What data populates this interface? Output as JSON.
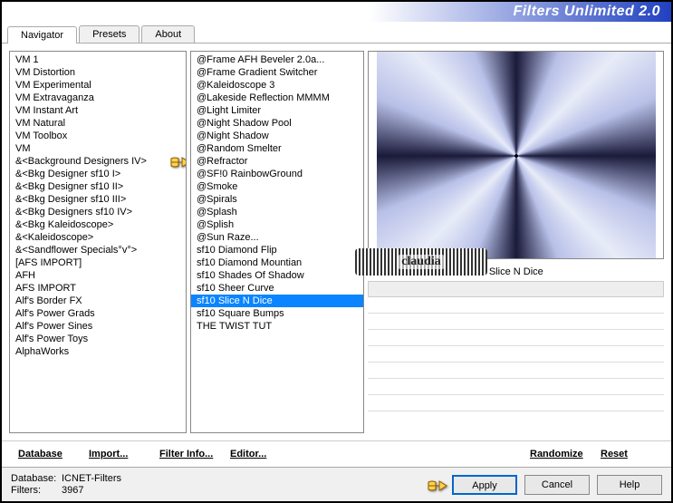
{
  "title": "Filters Unlimited 2.0",
  "tabs": [
    "Navigator",
    "Presets",
    "About"
  ],
  "categories": [
    "VM 1",
    "VM Distortion",
    "VM Experimental",
    "VM Extravaganza",
    "VM Instant Art",
    "VM Natural",
    "VM Toolbox",
    "VM",
    "&<Background Designers IV>",
    "&<Bkg Designer sf10 I>",
    "&<Bkg Designer sf10 II>",
    "&<Bkg Designer sf10 III>",
    "&<Bkg Designers sf10 IV>",
    "&<Bkg Kaleidoscope>",
    "&<Kaleidoscope>",
    "&<Sandflower Specials°v°>",
    "[AFS IMPORT]",
    "AFH",
    "AFS IMPORT",
    "Alf's Border FX",
    "Alf's Power Grads",
    "Alf's Power Sines",
    "Alf's Power Toys",
    "AlphaWorks"
  ],
  "category_pointer_index": 8,
  "filters": [
    "@Frame AFH Beveler 2.0a...",
    "@Frame Gradient Switcher",
    "@Kaleidoscope 3",
    "@Lakeside Reflection MMMM",
    "@Light Limiter",
    "@Night Shadow Pool",
    "@Night Shadow",
    "@Random Smelter",
    "@Refractor",
    "@SF!0 RainbowGround",
    "@Smoke",
    "@Spirals",
    "@Splash",
    "@Splish",
    "@Sun Raze...",
    "sf10 Diamond Flip",
    "sf10 Diamond Mountian",
    "sf10 Shades Of Shadow",
    "sf10 Sheer Curve",
    "sf10 Slice N Dice",
    "sf10 Square Bumps",
    "THE TWIST TUT"
  ],
  "filter_selected_index": 19,
  "preview_label": "sf10 Slice N Dice",
  "toolbar": {
    "database": "Database",
    "import": "Import...",
    "filter_info": "Filter Info...",
    "editor": "Editor...",
    "randomize": "Randomize",
    "reset": "Reset"
  },
  "footer": {
    "db_label": "Database:",
    "db_value": "ICNET-Filters",
    "filters_label": "Filters:",
    "filters_value": "3967",
    "apply": "Apply",
    "cancel": "Cancel",
    "help": "Help"
  },
  "watermark": "claudia"
}
